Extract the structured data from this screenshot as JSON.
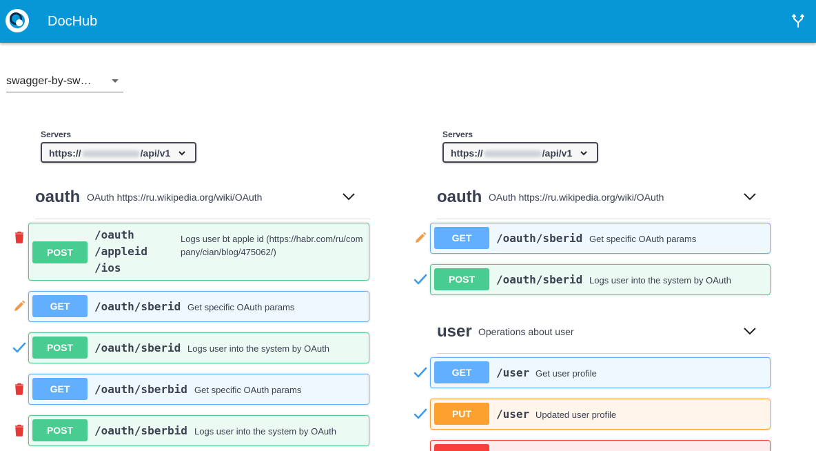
{
  "app": {
    "title": "DocHub"
  },
  "selector": {
    "value": "swagger-by-sw…"
  },
  "panels": [
    {
      "servers_label": "Servers",
      "server_prefix": "https://",
      "server_suffix": "/api/v1",
      "tags": [
        {
          "name": "oauth",
          "description": "OAuth https://ru.wikipedia.org/wiki/OAuth"
        }
      ],
      "operations": [
        {
          "status": "delete",
          "method": "POST",
          "path_lines": [
            "/oauth",
            "/appleid",
            "/ios"
          ],
          "summary": "Logs user bt apple id (https://habr.com/ru/company/cian/blog/475062/)"
        },
        {
          "status": "edit",
          "method": "GET",
          "path": "/oauth/sberid",
          "summary": "Get specific OAuth params"
        },
        {
          "status": "check",
          "method": "POST",
          "path": "/oauth/sberid",
          "summary": "Logs user into the system by OAuth"
        },
        {
          "status": "delete",
          "method": "GET",
          "path": "/oauth/sberbid",
          "summary": "Get specific OAuth params"
        },
        {
          "status": "delete",
          "method": "POST",
          "path": "/oauth/sberbid",
          "summary": "Logs user into the system by OAuth"
        }
      ]
    },
    {
      "servers_label": "Servers",
      "server_prefix": "https://",
      "server_suffix": "/api/v1",
      "tags": [
        {
          "name": "oauth",
          "description": "OAuth https://ru.wikipedia.org/wiki/OAuth"
        },
        {
          "name": "user",
          "description": "Operations about user"
        }
      ],
      "operations": [
        {
          "status": "edit",
          "method": "GET",
          "path": "/oauth/sberid",
          "summary": "Get specific OAuth params"
        },
        {
          "status": "check",
          "method": "POST",
          "path": "/oauth/sberid",
          "summary": "Logs user into the system by OAuth"
        },
        {
          "status": "check",
          "method": "GET",
          "path": "/user",
          "summary": "Get user profile"
        },
        {
          "status": "check",
          "method": "PUT",
          "path": "/user",
          "summary": "Updated user profile"
        }
      ]
    }
  ],
  "colors": {
    "app_bar": "#0796d6",
    "post": "#49cc90",
    "get": "#61affe",
    "put": "#fca130",
    "delete": "#f93e3e",
    "status_delete": "#e53935",
    "status_edit": "#f2994a",
    "status_check": "#3d9be9"
  }
}
